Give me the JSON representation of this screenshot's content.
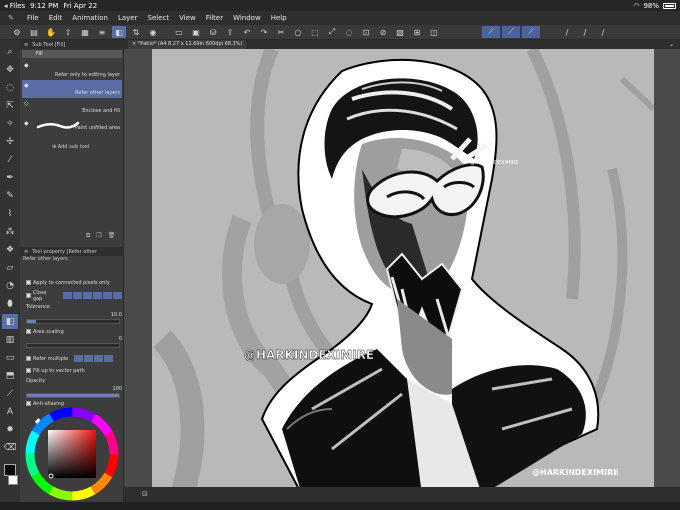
{
  "status": {
    "app_back": "Files",
    "time": "9:12 PM",
    "date": "Fri Apr 22",
    "battery": "98%"
  },
  "menu": {
    "items": [
      "File",
      "Edit",
      "Animation",
      "Layer",
      "Select",
      "View",
      "Filter",
      "Window",
      "Help"
    ]
  },
  "sub_tool_panel": {
    "title": "Sub Tool [Fill]",
    "tab": "Fill",
    "items": [
      {
        "label": "Refer only to editing layer"
      },
      {
        "label": "Refer other layers"
      },
      {
        "label": "Enclose and fill"
      },
      {
        "label": "Paint unfilled area"
      }
    ],
    "add_label": "Add sub tool"
  },
  "tool_property": {
    "title": "Tool property [Refer other",
    "subtitle": "Refer other layers",
    "apply_label": "Apply to connected pixels only",
    "close_gap_label": "Close gap",
    "tolerance_label": "Tolerance",
    "tolerance_value": "10.0",
    "area_scaling_label": "Area scaling",
    "area_scaling_value": "0",
    "refer_multiple_label": "Refer multiple",
    "fill_vector_label": "Fill up to vector path",
    "opacity_label": "Opacity",
    "opacity_value": "100",
    "antialias_label": "Anti-aliasing"
  },
  "document": {
    "tab_title": "*Pablo* (A4 8.27 x 11.69in 600dpi 68.3%)"
  },
  "artwork": {
    "watermark_main": "@HARKINDEXIMIRE",
    "watermark_corner": "@HARKINDEXIMIRE",
    "watermark_small": "@HARKINDEXIMIRE"
  },
  "colors": {
    "accent": "#5a6fa6",
    "panel": "#3d3d3d",
    "canvas_bg": "#b9b9b9",
    "main_color": "#0a0a0a",
    "sub_color": "#ffffff"
  }
}
